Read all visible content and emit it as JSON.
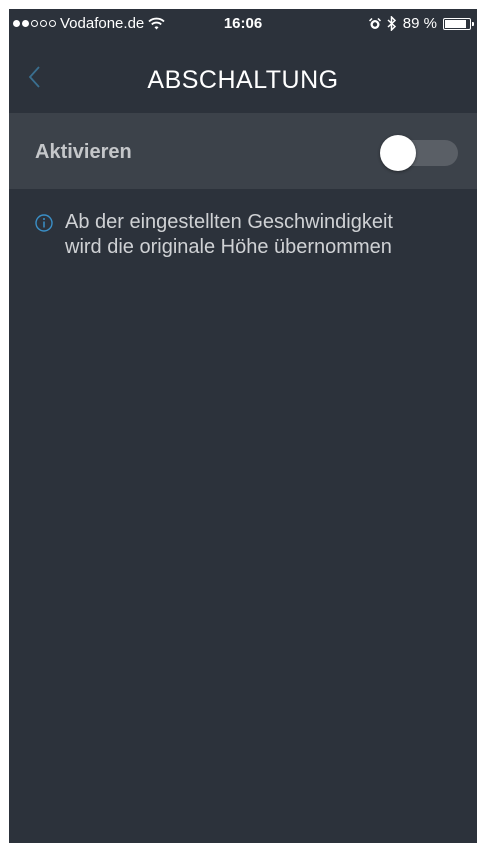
{
  "status_bar": {
    "carrier": "Vodafone.de",
    "time": "16:06",
    "battery_percent_label": "89 %",
    "battery_level": 0.89
  },
  "nav": {
    "title": "ABSCHALTUNG",
    "back_icon": "chevron-left-icon"
  },
  "toggle": {
    "label": "Aktivieren",
    "enabled": false
  },
  "info": {
    "icon": "info-icon",
    "line1": "Ab der eingestellten Geschwindigkeit",
    "line2": "wird die originale Höhe übernommen"
  },
  "colors": {
    "background": "#2c323b",
    "row_background": "#3c424a",
    "accent": "#3a6f8f"
  }
}
